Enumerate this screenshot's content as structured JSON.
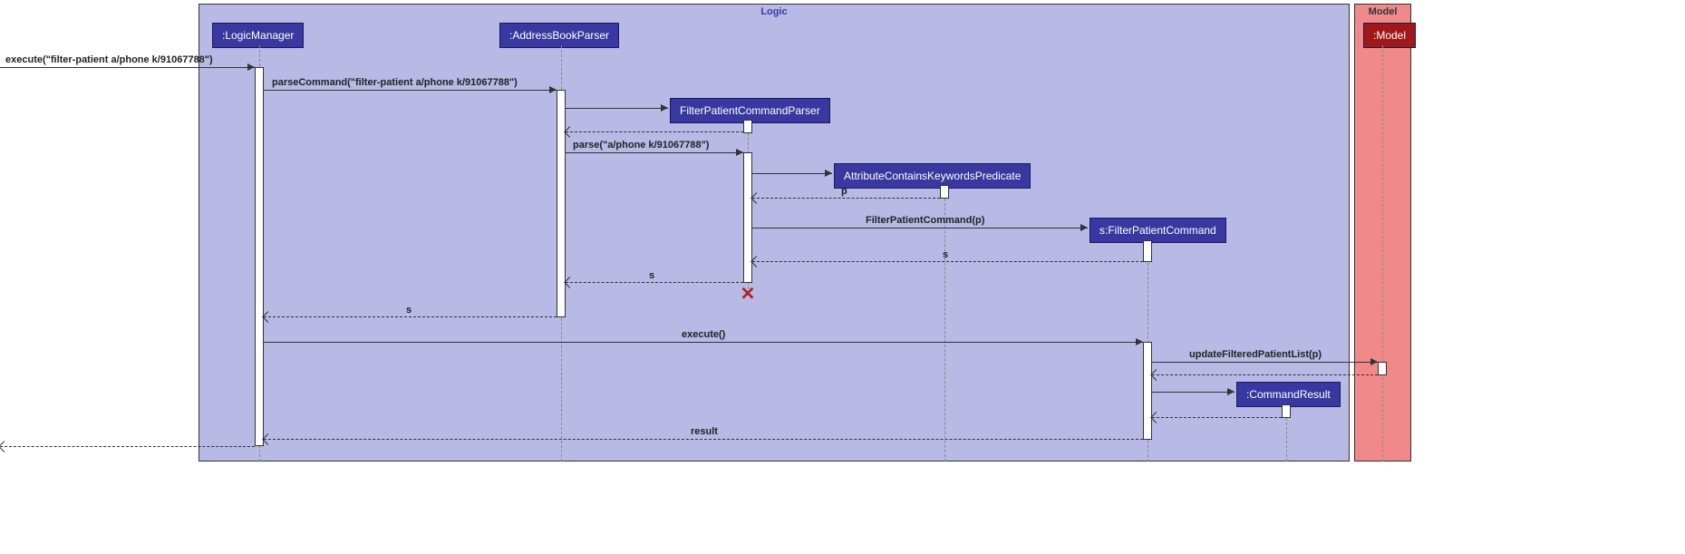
{
  "containers": {
    "logic": "Logic",
    "model": "Model"
  },
  "objects": {
    "logicManager": ":LogicManager",
    "addressBookParser": ":AddressBookParser",
    "filterPatientCommandParser": "FilterPatientCommandParser",
    "attributePredicate": "AttributeContainsKeywordsPredicate",
    "filterPatientCommand": "s:FilterPatientCommand",
    "model": ":Model",
    "commandResult": ":CommandResult"
  },
  "messages": {
    "execute1": "execute(\"filter-patient a/phone k/91067788\")",
    "parseCommand": "parseCommand(\"filter-patient a/phone k/91067788\")",
    "parse": "parse(\"a/phone k/91067788\")",
    "p": "p",
    "filterPatientCommandCreate": "FilterPatientCommand(p)",
    "s1": "s",
    "s2": "s",
    "s3": "s",
    "executeEmpty": "execute()",
    "updateFiltered": "updateFilteredPatientList(p)",
    "result": "result"
  }
}
